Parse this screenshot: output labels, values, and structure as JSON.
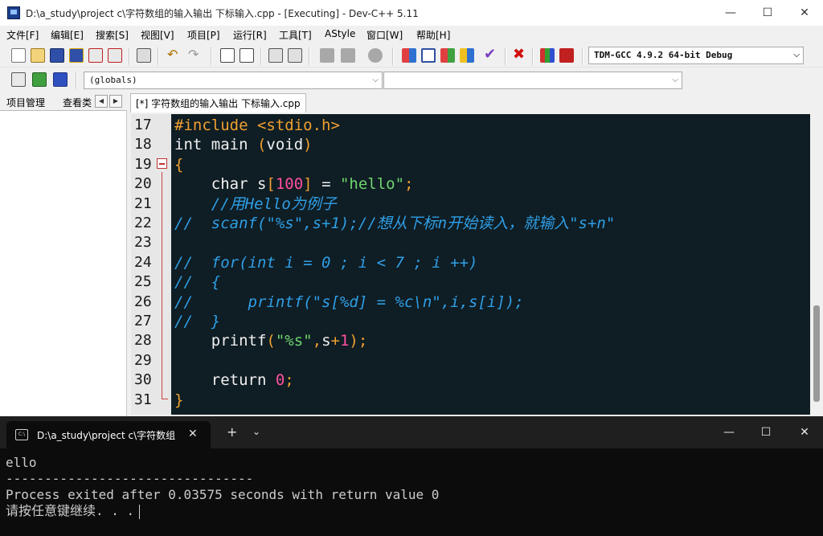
{
  "window": {
    "title": "D:\\a_study\\project  c\\字符数组的输入输出 下标输入.cpp - [Executing] - Dev-C++ 5.11",
    "controls": [
      "—",
      "☐",
      "✕"
    ]
  },
  "menu": [
    "文件[F]",
    "编辑[E]",
    "搜索[S]",
    "视图[V]",
    "项目[P]",
    "运行[R]",
    "工具[T]",
    "AStyle",
    "窗口[W]",
    "帮助[H]"
  ],
  "toolbar": {
    "compiler": "TDM-GCC 4.9.2 64-bit Debug",
    "scope": "(globals)",
    "member": ""
  },
  "left_panel": {
    "tabs": [
      "项目管理",
      "查看类"
    ]
  },
  "editor": {
    "tab_label": "[*] 字符数组的输入输出 下标输入.cpp",
    "lines": [
      {
        "n": "17",
        "parts": [
          {
            "t": "#include <stdio.h>",
            "c": "pre"
          }
        ]
      },
      {
        "n": "18",
        "parts": [
          {
            "t": "int main ",
            "c": "norm"
          },
          {
            "t": "(",
            "c": "brace"
          },
          {
            "t": "void",
            "c": "norm"
          },
          {
            "t": ")",
            "c": "brace"
          }
        ]
      },
      {
        "n": "19",
        "parts": [
          {
            "t": "{",
            "c": "brace"
          }
        ]
      },
      {
        "n": "20",
        "parts": [
          {
            "t": "    char s",
            "c": "norm"
          },
          {
            "t": "[",
            "c": "brace"
          },
          {
            "t": "100",
            "c": "num"
          },
          {
            "t": "]",
            "c": "brace"
          },
          {
            "t": " = ",
            "c": "norm"
          },
          {
            "t": "\"hello\"",
            "c": "str"
          },
          {
            "t": ";",
            "c": "brace"
          }
        ]
      },
      {
        "n": "21",
        "parts": [
          {
            "t": "    //用Hello为例子",
            "c": "cmt"
          }
        ]
      },
      {
        "n": "22",
        "parts": [
          {
            "t": "//  scanf(\"%s\",s+1);//想从下标n开始读入，就输入\"s+n\"",
            "c": "cmt"
          }
        ]
      },
      {
        "n": "23",
        "parts": []
      },
      {
        "n": "24",
        "parts": [
          {
            "t": "//  for(int i = 0 ; i < 7 ; i ++)",
            "c": "cmt"
          }
        ]
      },
      {
        "n": "25",
        "parts": [
          {
            "t": "//  {",
            "c": "cmt"
          }
        ]
      },
      {
        "n": "26",
        "parts": [
          {
            "t": "//      printf(\"s[%d] = %c\\n\",i,s[i]);",
            "c": "cmt"
          }
        ]
      },
      {
        "n": "27",
        "parts": [
          {
            "t": "//  }",
            "c": "cmt"
          }
        ]
      },
      {
        "n": "28",
        "parts": [
          {
            "t": "    printf",
            "c": "norm"
          },
          {
            "t": "(",
            "c": "brace"
          },
          {
            "t": "\"%s\"",
            "c": "str"
          },
          {
            "t": ",",
            "c": "brace"
          },
          {
            "t": "s",
            "c": "norm"
          },
          {
            "t": "+",
            "c": "brace"
          },
          {
            "t": "1",
            "c": "num"
          },
          {
            "t": ");",
            "c": "brace"
          }
        ]
      },
      {
        "n": "29",
        "parts": []
      },
      {
        "n": "30",
        "parts": [
          {
            "t": "    return ",
            "c": "norm"
          },
          {
            "t": "0",
            "c": "num"
          },
          {
            "t": ";",
            "c": "brace"
          }
        ]
      },
      {
        "n": "31",
        "parts": [
          {
            "t": "}",
            "c": "brace"
          }
        ]
      }
    ]
  },
  "terminal": {
    "tab_title": "D:\\a_study\\project  c\\字符数组",
    "lines": [
      "ello",
      "--------------------------------",
      "Process exited after 0.03575 seconds with return value 0",
      "请按任意键继续. . ."
    ]
  },
  "colors": {
    "editor_bg": "#0f1d24",
    "comment": "#2f9fe6",
    "string": "#6fd46f",
    "number": "#ff4fa0",
    "preprocessor": "#f0a030"
  }
}
